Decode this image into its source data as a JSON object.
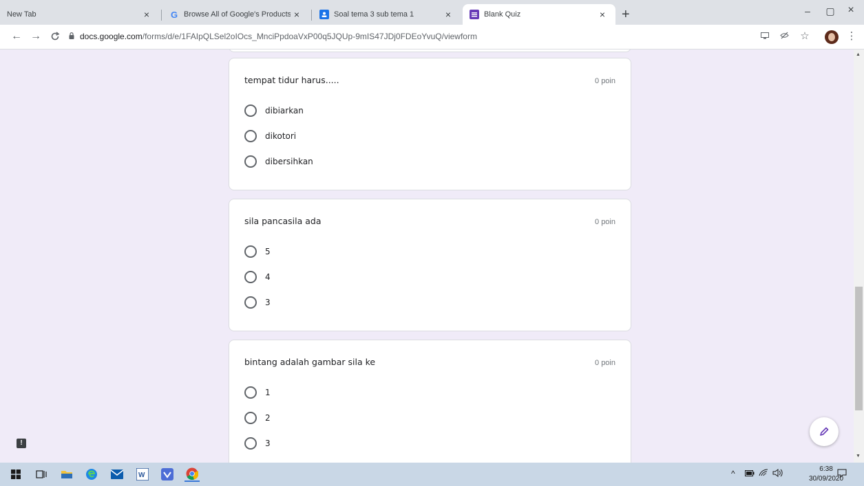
{
  "tabs": [
    {
      "label": "New Tab",
      "close": "×"
    },
    {
      "label": "Browse All of Google's Products",
      "close": "×"
    },
    {
      "label": "Soal tema 3 sub tema 1",
      "close": "×"
    },
    {
      "label": "Blank Quiz",
      "close": "×"
    }
  ],
  "new_tab": "+",
  "window_controls": {
    "minimize": "–",
    "maximize": "▢",
    "close": "×"
  },
  "address": {
    "host": "docs.google.com",
    "path": "/forms/d/e/1FAIpQLSel2oIOcs_MnciPpdoaVxP00q5JQUp-9mIS47JDj0FDEoYvuQ/viewform"
  },
  "questions": [
    {
      "title": "tempat tidur harus.....",
      "points": "0 poin",
      "options": [
        "dibiarkan",
        "dikotori",
        "dibersihkan"
      ]
    },
    {
      "title": "sila pancasila ada",
      "points": "0 poin",
      "options": [
        "5",
        "4",
        "3"
      ]
    },
    {
      "title": "bintang adalah gambar sila ke",
      "points": "0 poin",
      "options": [
        "1",
        "2",
        "3"
      ]
    }
  ],
  "taskbar": {
    "time": "6:38",
    "date": "30/09/2020"
  },
  "icons": [
    "back-icon",
    "forward-icon",
    "reload-icon",
    "lock-icon",
    "cast-icon",
    "eye-off-icon",
    "star-icon",
    "menu-dots-icon",
    "edit-pencil-icon",
    "report-icon",
    "windows-start-icon",
    "task-view-icon",
    "file-explorer-icon",
    "edge-icon",
    "mail-icon",
    "word-icon",
    "store-icon",
    "chrome-icon"
  ],
  "colors": {
    "page_bg": "#f0ebf8",
    "accent": "#673ab7",
    "taskbar": "#c9d7e6"
  }
}
